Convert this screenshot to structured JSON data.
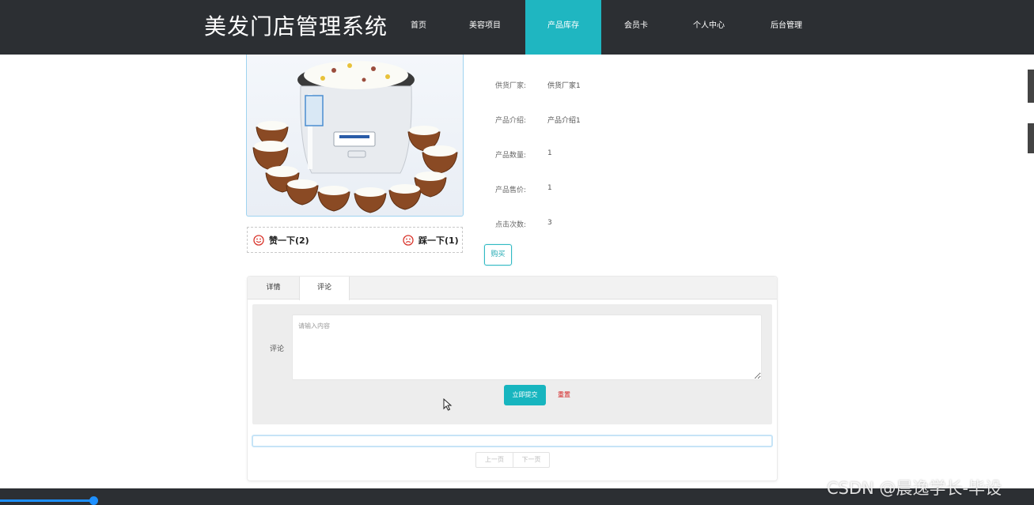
{
  "header": {
    "brand": "美发门店管理系统",
    "nav": [
      {
        "label": "首页",
        "active": false
      },
      {
        "label": "美容项目",
        "active": false
      },
      {
        "label": "产品库存",
        "active": true
      },
      {
        "label": "会员卡",
        "active": false
      },
      {
        "label": "个人中心",
        "active": false
      },
      {
        "label": "后台管理",
        "active": false
      }
    ]
  },
  "product": {
    "votes": {
      "up_label": "赞一下(2)",
      "down_label": "踩一下(1)"
    },
    "info": [
      {
        "label": "供货厂家:",
        "value": "供货厂家1"
      },
      {
        "label": "产品介绍:",
        "value": "产品介绍1"
      },
      {
        "label": "产品数量:",
        "value": "1"
      },
      {
        "label": "产品售价:",
        "value": "1"
      },
      {
        "label": "点击次数:",
        "value": "3"
      }
    ],
    "buy_label": "购买"
  },
  "tabs": [
    {
      "label": "详情",
      "active": false
    },
    {
      "label": "评论",
      "active": true
    }
  ],
  "comment_form": {
    "label": "评论",
    "placeholder": "请输入内容",
    "value": "",
    "submit_label": "立即提交",
    "reset_label": "重置"
  },
  "pagination": {
    "prev_label": "上一页",
    "next_label": "下一页"
  },
  "watermark": "CSDN @晨逸学长-毕设",
  "colors": {
    "accent": "#1fb6c1",
    "header_bg": "#2c2f33",
    "reset": "#d21a1a"
  }
}
